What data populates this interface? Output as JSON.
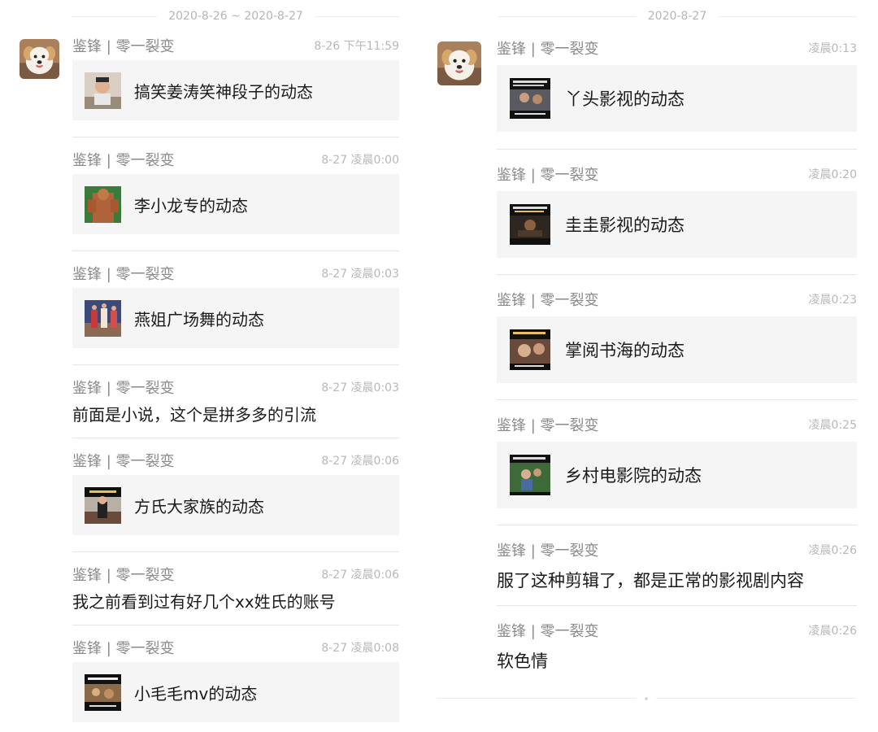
{
  "left_panel": {
    "date_range": "2020-8-26 ~ 2020-8-27",
    "messages": [
      {
        "sender": "鉴锋 | 零一裂变",
        "time": "8-26 下午11:59",
        "kind": "card",
        "card_title": "搞笑姜涛笑神段子的动态",
        "thumb": "person-photo-thumbnail"
      },
      {
        "sender": "鉴锋 | 零一裂变",
        "time": "8-27 凌晨0:00",
        "kind": "card",
        "card_title": "李小龙专的动态",
        "thumb": "muscle-photo-thumbnail"
      },
      {
        "sender": "鉴锋 | 零一裂变",
        "time": "8-27 凌晨0:03",
        "kind": "card",
        "card_title": "燕姐广场舞的动态",
        "thumb": "dance-photo-thumbnail"
      },
      {
        "sender": "鉴锋 | 零一裂变",
        "time": "8-27 凌晨0:03",
        "kind": "text",
        "text": "前面是小说，这个是拼多多的引流"
      },
      {
        "sender": "鉴锋 | 零一裂变",
        "time": "8-27 凌晨0:06",
        "kind": "card",
        "card_title": "方氏大家族的动态",
        "thumb": "family-photo-thumbnail"
      },
      {
        "sender": "鉴锋 | 零一裂变",
        "time": "8-27 凌晨0:06",
        "kind": "text",
        "text": "我之前看到过有好几个xx姓氏的账号"
      },
      {
        "sender": "鉴锋 | 零一裂变",
        "time": "8-27 凌晨0:08",
        "kind": "card",
        "card_title": "小毛毛mv的动态",
        "thumb": "mv-photo-thumbnail"
      }
    ]
  },
  "right_panel": {
    "date": "2020-8-27",
    "messages": [
      {
        "sender": "鉴锋 | 零一裂变",
        "time": "凌晨0:13",
        "kind": "card",
        "card_title": "丫头影视的动态",
        "thumb": "video-still-thumbnail"
      },
      {
        "sender": "鉴锋 | 零一裂变",
        "time": "凌晨0:20",
        "kind": "card",
        "card_title": "圭圭影视的动态",
        "thumb": "video-still-thumbnail"
      },
      {
        "sender": "鉴锋 | 零一裂变",
        "time": "凌晨0:23",
        "kind": "card",
        "card_title": "掌阅书海的动态",
        "thumb": "video-still-thumbnail"
      },
      {
        "sender": "鉴锋 | 零一裂变",
        "time": "凌晨0:25",
        "kind": "card",
        "card_title": "乡村电影院的动态",
        "thumb": "video-still-thumbnail"
      },
      {
        "sender": "鉴锋 | 零一裂变",
        "time": "凌晨0:26",
        "kind": "text",
        "text": "服了这种剪辑了，都是正常的影视剧内容"
      },
      {
        "sender": "鉴锋 | 零一裂变",
        "time": "凌晨0:26",
        "kind": "text",
        "text": "软色情"
      }
    ]
  },
  "avatar": "puppy-avatar",
  "colors": {
    "card_bg": "#f5f5f5",
    "meta_text": "#8a8a8a",
    "time_text": "#b8b8b8",
    "body_text": "#1a1a1a",
    "divider": "#e6e6e6"
  }
}
